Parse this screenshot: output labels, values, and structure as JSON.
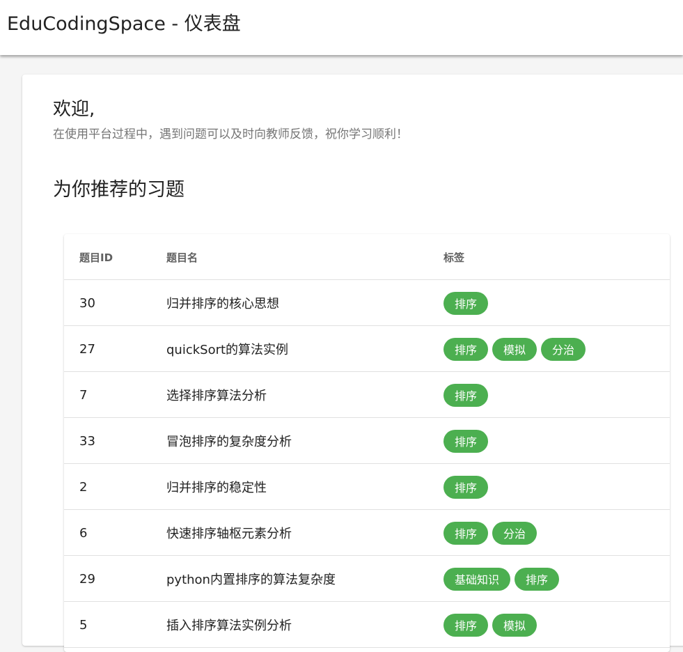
{
  "app": {
    "title": "EduCodingSpace - 仪表盘"
  },
  "welcome": {
    "heading": "欢迎,",
    "message": "在使用平台过程中，遇到问题可以及时向教师反馈，祝你学习顺利！"
  },
  "recommend": {
    "title": "为你推荐的习题",
    "columns": {
      "id": "题目ID",
      "name": "题目名",
      "tags": "标签"
    },
    "rows": [
      {
        "id": "30",
        "name": "归并排序的核心思想",
        "tags": [
          "排序"
        ]
      },
      {
        "id": "27",
        "name": "quickSort的算法实例",
        "tags": [
          "排序",
          "模拟",
          "分治"
        ]
      },
      {
        "id": "7",
        "name": "选择排序算法分析",
        "tags": [
          "排序"
        ]
      },
      {
        "id": "33",
        "name": "冒泡排序的复杂度分析",
        "tags": [
          "排序"
        ]
      },
      {
        "id": "2",
        "name": "归并排序的稳定性",
        "tags": [
          "排序"
        ]
      },
      {
        "id": "6",
        "name": "快速排序轴枢元素分析",
        "tags": [
          "排序",
          "分治"
        ]
      },
      {
        "id": "29",
        "name": "python内置排序的算法复杂度",
        "tags": [
          "基础知识",
          "排序"
        ]
      },
      {
        "id": "5",
        "name": "插入排序算法实例分析",
        "tags": [
          "排序",
          "模拟"
        ]
      }
    ]
  },
  "colors": {
    "chip": "#4caf50",
    "chip_text": "#ffffff"
  }
}
